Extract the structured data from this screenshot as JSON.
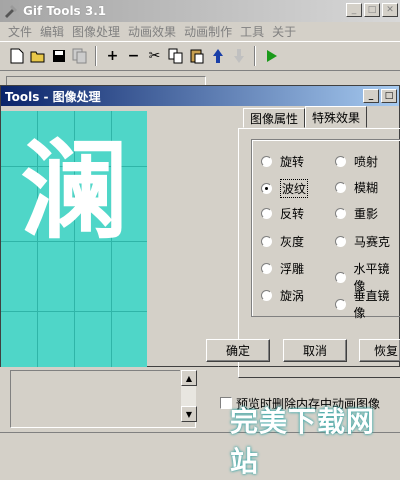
{
  "main_window": {
    "title": "Gif Tools 3.1",
    "menu": [
      "文件",
      "编辑",
      "图像处理",
      "动画效果",
      "动画制作",
      "工具",
      "关于"
    ],
    "toolbar": [
      "new-icon",
      "open-icon",
      "save-icon",
      "copy-doc-icon",
      "plus-icon",
      "minus-icon",
      "cut-icon",
      "copy-icon",
      "paste-icon",
      "up-arrow-icon",
      "down-arrow-icon",
      "play-icon"
    ],
    "checkbox_label": "预览时删除内存中动画图像"
  },
  "dialog": {
    "title": "Tools - 图像处理",
    "preview_char": "澜",
    "preview_color": "#4fd6c8",
    "tabs": [
      "图像属性",
      "特殊效果"
    ],
    "active_tab": "特殊效果",
    "effects_left": [
      "旋转",
      "波纹",
      "反转",
      "灰度",
      "浮雕",
      "旋涡"
    ],
    "effects_right": [
      "喷射",
      "模糊",
      "重影",
      "马赛克",
      "水平镜像",
      "垂直镜像"
    ],
    "selected_effect": "波纹",
    "buttons": {
      "ok": "确定",
      "cancel": "取消",
      "restore": "恢复"
    }
  },
  "watermark": "完美下载网站",
  "colors": {
    "dialog_title_start": "#0a246a",
    "dialog_title_end": "#a6caf0",
    "face": "#d4d0c8"
  }
}
